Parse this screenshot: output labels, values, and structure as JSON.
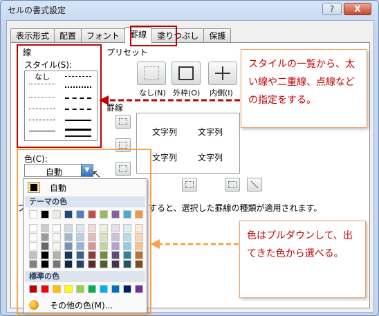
{
  "window": {
    "title": "セルの書式設定",
    "help": "?",
    "close": "X"
  },
  "tabs": [
    {
      "label": "表示形式"
    },
    {
      "label": "配置"
    },
    {
      "label": "フォント"
    },
    {
      "label": "罫線"
    },
    {
      "label": "塗りつぶし"
    },
    {
      "label": "保護"
    }
  ],
  "line": {
    "group_label": "線",
    "style_label": "スタイル(S):",
    "none_label": "なし",
    "color_label": "色(C):",
    "color_value": "自動"
  },
  "preset": {
    "group_label": "プリセット",
    "buttons": [
      {
        "label": "なし(N)"
      },
      {
        "label": "外枠(O)"
      },
      {
        "label": "内側(I)"
      }
    ]
  },
  "border": {
    "group_label": "罫線",
    "preview_text": [
      "文字列",
      "文字列",
      "文字列",
      "文字列"
    ]
  },
  "hint": {
    "prefix": "プ",
    "text": "すると、選択した罫線の種類が適用されます。"
  },
  "palette": {
    "auto_label": "自動",
    "theme_header": "テーマの色",
    "standard_header": "標準の色",
    "more_label": "その他の色(M)...",
    "theme_colors": [
      "#ffffff",
      "#000000",
      "#eeece1",
      "#1f497d",
      "#4f81bd",
      "#c0504d",
      "#9bbb59",
      "#8064a2",
      "#4bacc6",
      "#f79646"
    ],
    "standard_colors": [
      "#c00000",
      "#ff0000",
      "#ffc000",
      "#ffff00",
      "#92d050",
      "#00b050",
      "#00b0f0",
      "#0070c0",
      "#002060",
      "#7030a0"
    ]
  },
  "notes": {
    "style_note": "スタイルの一覧から、太い線や二重線、点線などの指定をする。",
    "color_note": "色はプルダウンして、出てきた色から選べる。"
  },
  "colors": {
    "accent_red": "#c00000",
    "accent_orange": "#f6a34c"
  }
}
